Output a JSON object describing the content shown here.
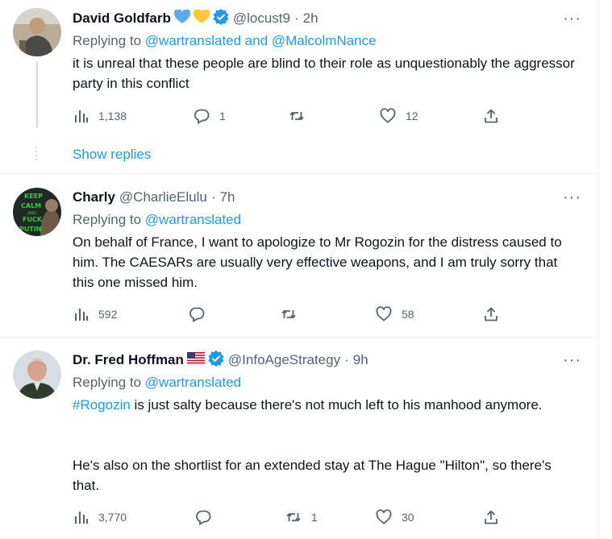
{
  "tweets": [
    {
      "name": "David Goldfarb",
      "handle": "@locust9",
      "time": "2h",
      "reply_prefix": "Replying to ",
      "reply_targets": "@wartranslated and @MalcolmNance",
      "text": "it is unreal that these people are blind to their role as unquestionably the aggressor party in this conflict",
      "views": "1,138",
      "replies": "1",
      "retweets": "",
      "likes": "12"
    },
    {
      "name": "Charly",
      "handle": "@CharlieElulu",
      "time": "7h",
      "avatar_text": [
        "KEEP",
        "CALM",
        "AND",
        "FUCK",
        "PUTIN"
      ],
      "reply_prefix": "Replying to ",
      "reply_targets": "@wartranslated",
      "text": "On behalf of France, I want to apologize to Mr Rogozin for the distress caused to him. The CAESARs are usually very effective weapons, and I am truly sorry that this one missed him.",
      "views": "592",
      "replies": "",
      "retweets": "",
      "likes": "58"
    },
    {
      "name": "Dr. Fred Hoffman",
      "handle": "@InfoAgeStrategy",
      "time": "9h",
      "reply_prefix": "Replying to ",
      "reply_targets": "@wartranslated",
      "hashtag": "#Rogozin",
      "text_after_hashtag": " is just salty because there's not much left to his manhood anymore.",
      "text_para2": "He's also on the shortlist for an extended stay at The Hague \"Hilton\", so there's that.",
      "views": "3,770",
      "replies": "",
      "retweets": "1",
      "likes": "30"
    }
  ],
  "show_replies_label": "Show replies",
  "separator": "·",
  "more_label": "···",
  "colors": {
    "accent": "#1d9bf0",
    "text": "#0f1419",
    "secondary": "#536471",
    "border": "#eff3f4",
    "heart_blue": "#5da8ee",
    "heart_yellow": "#fcc934"
  },
  "icons": [
    "verified-badge-icon",
    "views-icon",
    "reply-icon",
    "retweet-icon",
    "like-icon",
    "share-icon",
    "more-icon",
    "heart-emoji-icon",
    "us-flag-icon"
  ]
}
